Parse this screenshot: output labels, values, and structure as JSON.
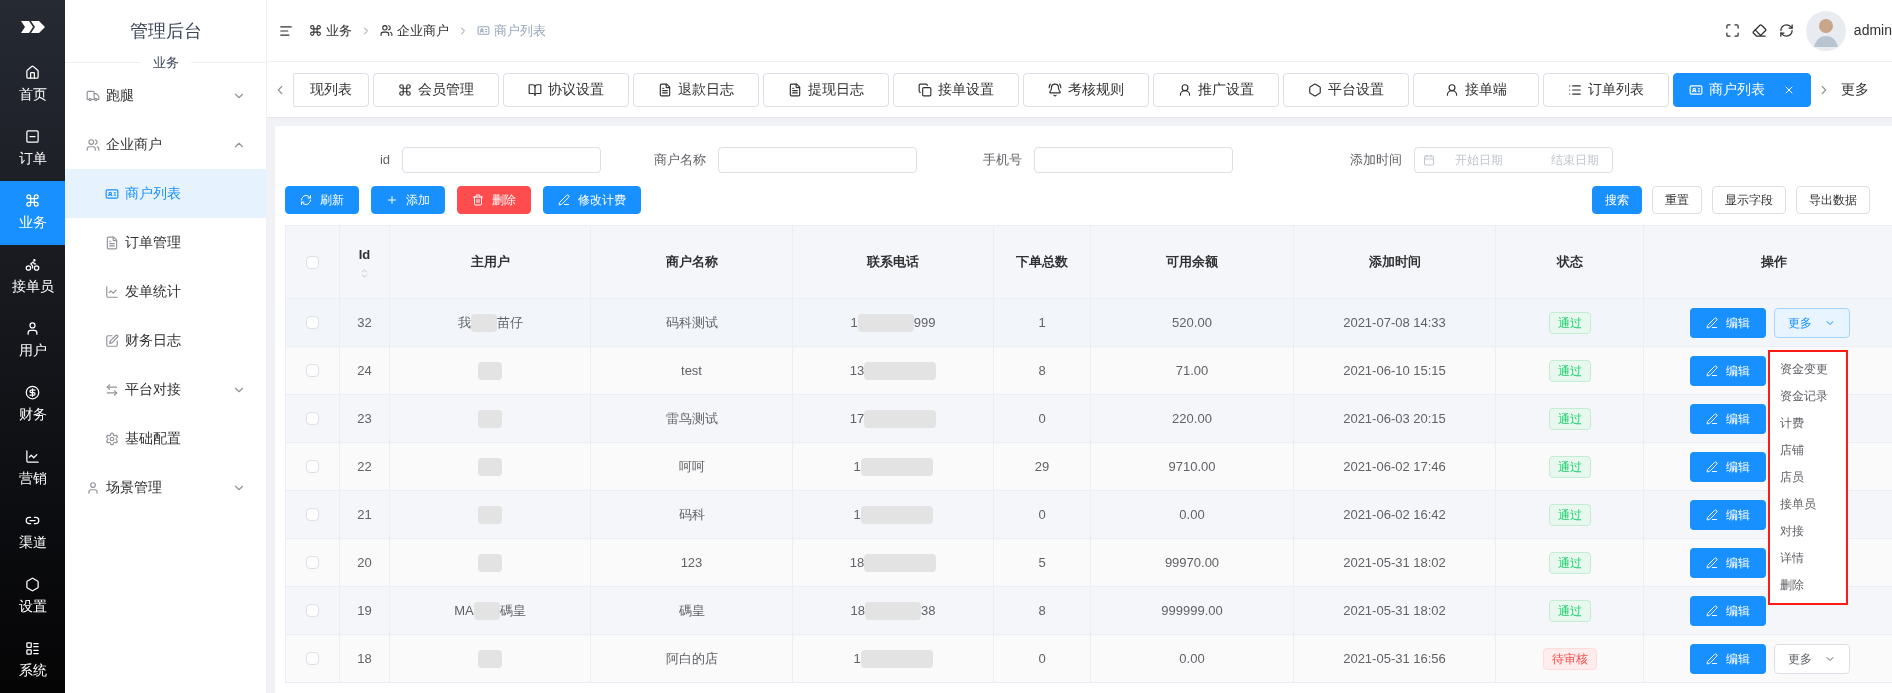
{
  "rail": {
    "items": [
      {
        "label": "首页",
        "selected": false
      },
      {
        "label": "订单",
        "selected": false
      },
      {
        "label": "业务",
        "selected": true
      },
      {
        "label": "接单员",
        "selected": false
      },
      {
        "label": "用户",
        "selected": false
      },
      {
        "label": "财务",
        "selected": false
      },
      {
        "label": "营销",
        "selected": false
      },
      {
        "label": "渠道",
        "selected": false
      },
      {
        "label": "设置",
        "selected": false
      },
      {
        "label": "系统",
        "selected": false
      }
    ]
  },
  "submenu": {
    "title": "管理后台",
    "section": "业务",
    "items": [
      {
        "label": "跑腿",
        "expanded": false
      },
      {
        "label": "企业商户",
        "expanded": true,
        "children": [
          {
            "label": "商户列表",
            "selected": true,
            "expandable": false
          },
          {
            "label": "订单管理",
            "selected": false,
            "expandable": false
          },
          {
            "label": "发单统计",
            "selected": false,
            "expandable": false
          },
          {
            "label": "财务日志",
            "selected": false,
            "expandable": false
          },
          {
            "label": "平台对接",
            "selected": false,
            "expandable": true
          },
          {
            "label": "基础配置",
            "selected": false,
            "expandable": false
          }
        ]
      },
      {
        "label": "场景管理",
        "expanded": false
      }
    ]
  },
  "breadcrumb": [
    {
      "label": "业务",
      "current": false
    },
    {
      "label": "企业商户",
      "current": false
    },
    {
      "label": "商户列表",
      "current": true
    }
  ],
  "user": {
    "name": "admin"
  },
  "tabs": [
    {
      "label": "现列表",
      "selected": false,
      "closable": false
    },
    {
      "label": "会员管理",
      "selected": false,
      "closable": false
    },
    {
      "label": "协议设置",
      "selected": false,
      "closable": false
    },
    {
      "label": "退款日志",
      "selected": false,
      "closable": false
    },
    {
      "label": "提现日志",
      "selected": false,
      "closable": false
    },
    {
      "label": "接单设置",
      "selected": false,
      "closable": false
    },
    {
      "label": "考核规则",
      "selected": false,
      "closable": false
    },
    {
      "label": "推广设置",
      "selected": false,
      "closable": false
    },
    {
      "label": "平台设置",
      "selected": false,
      "closable": false
    },
    {
      "label": "接单端",
      "selected": false,
      "closable": false
    },
    {
      "label": "订单列表",
      "selected": false,
      "closable": false
    },
    {
      "label": "商户列表",
      "selected": true,
      "closable": true
    }
  ],
  "tabs_more": "更多",
  "filters": [
    {
      "label": "id",
      "kind": "text"
    },
    {
      "label": "商户名称",
      "kind": "text"
    },
    {
      "label": "手机号",
      "kind": "text"
    },
    {
      "label": "添加时间",
      "kind": "daterange",
      "start_placeholder": "开始日期",
      "end_placeholder": "结束日期"
    }
  ],
  "actions_left": [
    {
      "label": "刷新",
      "kind": "primary"
    },
    {
      "label": "添加",
      "kind": "primary"
    },
    {
      "label": "删除",
      "kind": "danger"
    },
    {
      "label": "修改计费",
      "kind": "primary"
    }
  ],
  "actions_right": [
    {
      "label": "搜索",
      "kind": "primary"
    },
    {
      "label": "重置",
      "kind": "plain"
    },
    {
      "label": "显示字段",
      "kind": "plain"
    },
    {
      "label": "导出数据",
      "kind": "plain"
    }
  ],
  "table": {
    "all_checked": false,
    "columns": [
      "Id",
      "主用户",
      "商户名称",
      "联系电话",
      "下单总数",
      "可用余额",
      "添加时间",
      "状态",
      "操作"
    ],
    "rows": [
      {
        "checked": false,
        "id": "32",
        "owner": {
          "before": "我",
          "after": "苗仔"
        },
        "name": "码科测试",
        "phone": {
          "before": "1",
          "after": "999"
        },
        "orders": "1",
        "balance": "520.00",
        "added": "2021-07-08 14:33",
        "status": {
          "label": "通过",
          "kind": "success"
        },
        "edit": "编辑",
        "more": "更多",
        "more_open": true
      },
      {
        "checked": false,
        "id": "24",
        "name": "test",
        "phone": {
          "before": "13"
        },
        "orders": "8",
        "balance": "71.00",
        "added": "2021-06-10 15:15",
        "status": {
          "label": "通过",
          "kind": "success"
        },
        "edit": "编辑"
      },
      {
        "checked": false,
        "id": "23",
        "name": "雷鸟测试",
        "phone": {
          "before": "17"
        },
        "orders": "0",
        "balance": "220.00",
        "added": "2021-06-03 20:15",
        "status": {
          "label": "通过",
          "kind": "success"
        },
        "edit": "编辑"
      },
      {
        "checked": false,
        "id": "22",
        "name": "呵呵",
        "phone": {
          "before": "1"
        },
        "orders": "29",
        "balance": "9710.00",
        "added": "2021-06-02 17:46",
        "status": {
          "label": "通过",
          "kind": "success"
        },
        "edit": "编辑"
      },
      {
        "checked": false,
        "id": "21",
        "name": "码科",
        "phone": {
          "before": "1"
        },
        "orders": "0",
        "balance": "0.00",
        "added": "2021-06-02 16:42",
        "status": {
          "label": "通过",
          "kind": "success"
        },
        "edit": "编辑"
      },
      {
        "checked": false,
        "id": "20",
        "name": "123",
        "phone": {
          "before": "18"
        },
        "orders": "5",
        "balance": "99970.00",
        "added": "2021-05-31 18:02",
        "status": {
          "label": "通过",
          "kind": "success"
        },
        "edit": "编辑"
      },
      {
        "checked": false,
        "id": "19",
        "owner": {
          "before": "MA",
          "after": "碼皇"
        },
        "name": "碼皇",
        "phone": {
          "before": "18",
          "after": "38"
        },
        "orders": "8",
        "balance": "999999.00",
        "added": "2021-05-31 18:02",
        "status": {
          "label": "通过",
          "kind": "success"
        },
        "edit": "编辑"
      },
      {
        "checked": false,
        "id": "18",
        "name": "阿白的店",
        "phone": {
          "before": "1"
        },
        "orders": "0",
        "balance": "0.00",
        "added": "2021-05-31 16:56",
        "status": {
          "label": "待审核",
          "kind": "danger"
        },
        "edit": "编辑",
        "more": "更多",
        "more_open": false
      }
    ]
  },
  "dropdown": [
    "资金变更",
    "资金记录",
    "计费",
    "店铺",
    "店员",
    "接单员",
    "对接",
    "详情",
    "删除"
  ]
}
